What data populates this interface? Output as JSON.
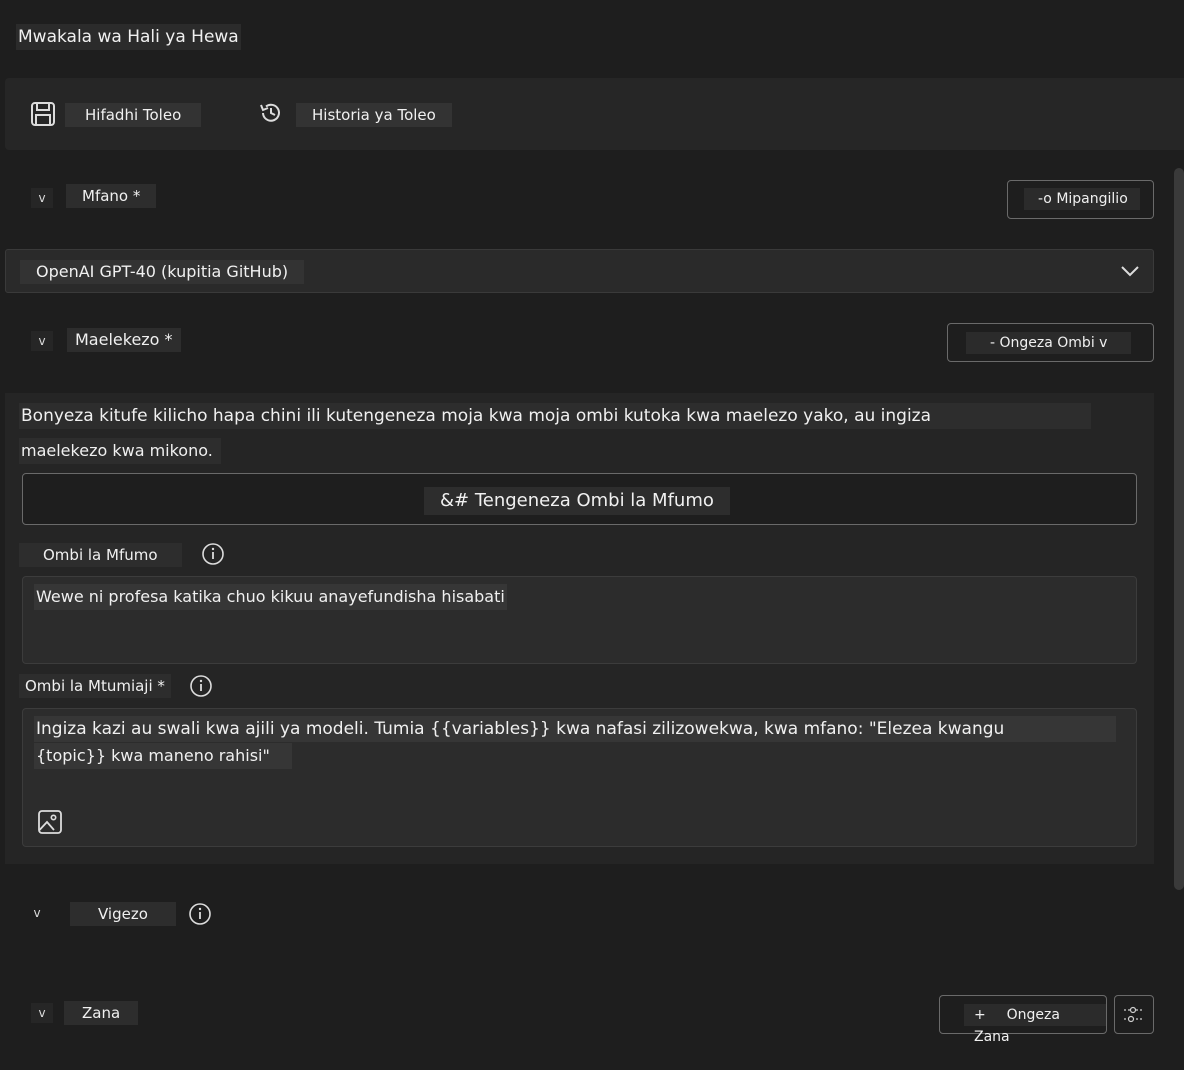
{
  "window": {
    "title": "Mwakala wa Hali ya Hewa"
  },
  "toolbar": {
    "save_label": "Hifadhi Toleo",
    "history_label": "Historia ya Toleo",
    "save_icon": "save-icon",
    "history_icon": "history-icon"
  },
  "model_section": {
    "chevron": "v",
    "label": "Mfano *",
    "settings_button": "-o Mipangilio",
    "selected_model": "OpenAI GPT-40 (kupitia GitHub)"
  },
  "instructions_section": {
    "chevron": "v",
    "label": "Maelekezo *",
    "add_prompt_button": "- Ongeza Ombi v",
    "description_line1": "Bonyeza kitufe kilicho hapa chini ili kutengeneza moja kwa moja ombi kutoka kwa maelezo yako, au ingiza",
    "description_line2": "maelekezo kwa mikono.",
    "generate_button": "&# Tengeneza Ombi la Mfumo",
    "system_prompt_label": "Ombi la Mfumo",
    "system_prompt_value": "Wewe ni profesa katika chuo kikuu anayefundisha hisabati",
    "user_prompt_label": "Ombi la Mtumiaji *",
    "user_prompt_placeholder_line1": "Ingiza kazi au swali kwa ajili ya modeli. Tumia {{variables}} kwa nafasi zilizowekwa, kwa mfano: \"Elezea kwangu",
    "user_prompt_placeholder_line2": "{topic}} kwa maneno rahisi\""
  },
  "variables_section": {
    "chevron": "v",
    "label": "Vigezo"
  },
  "tools_section": {
    "chevron": "v",
    "label": "Zana",
    "add_tool_plus": "+",
    "add_tool_button": "Ongeza Zana"
  },
  "colors": {
    "background": "#1e1e1e",
    "panel": "#252525",
    "text": "#f0f0f0",
    "border": "#6a6a6a"
  }
}
